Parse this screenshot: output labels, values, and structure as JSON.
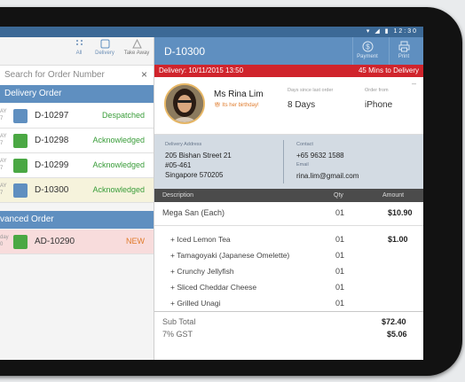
{
  "statusbar": {
    "time": "12:30"
  },
  "filters": [
    {
      "label": "All",
      "icon": "grid-icon"
    },
    {
      "label": "Delivery",
      "icon": "box-icon"
    },
    {
      "label": "Take Away",
      "icon": "triangle-icon"
    }
  ],
  "search": {
    "placeholder": "Search for Order Number"
  },
  "delivery_section": {
    "title": "Delivery Order"
  },
  "delivery_orders": [
    {
      "time_top": "AY",
      "time_bottom": "7",
      "id": "D-10297",
      "status": "Despatched",
      "status_color": "#3a9d3a",
      "square_color": "#5f8fc0",
      "bg": "#ffffff"
    },
    {
      "time_top": "AY",
      "time_bottom": "7",
      "id": "D-10298",
      "status": "Acknowledged",
      "status_color": "#3a9d3a",
      "square_color": "#4aa843",
      "bg": "#ffffff"
    },
    {
      "time_top": "AY",
      "time_bottom": "7",
      "id": "D-10299",
      "status": "Acknowledged",
      "status_color": "#3a9d3a",
      "square_color": "#4aa843",
      "bg": "#ffffff"
    },
    {
      "time_top": "AY",
      "time_bottom": "7",
      "id": "D-10300",
      "status": "Acknowledged",
      "status_color": "#3a9d3a",
      "square_color": "#5f8fc0",
      "bg": "#f6f3dc"
    }
  ],
  "advanced_section": {
    "title": "vanced Order"
  },
  "advanced_orders": [
    {
      "time_top": "day",
      "time_bottom": "0",
      "id": "AD-10290",
      "status": "NEW",
      "status_color": "#e07b2b",
      "square_color": "#4aa843",
      "bg": "#f8dcdc"
    }
  ],
  "detail": {
    "order_id": "D-10300",
    "payment_label": "Payment",
    "print_label": "Print",
    "delivery_banner": "Delivery: 10/11/2015 13:50",
    "eta_banner": "45 Mins to Delivery",
    "customer": {
      "name": "Ms Rina Lim",
      "birthday_note": "Its her birthday!",
      "days_label": "Days since last order",
      "days_value": "8 Days",
      "order_from_label": "Order from",
      "order_from_value": "iPhone"
    },
    "address_label": "Delivery Address",
    "address_line1": "205 Bishan Street 21",
    "address_line2": "#05-461",
    "address_line3": "Singapore 570205",
    "contact_label": "Contact",
    "contact_value": "+65 9632 1588",
    "email_label": "Email",
    "email_value": "rina.lim@gmail.com",
    "columns": {
      "description": "Description",
      "qty": "Qty",
      "amount": "Amount"
    },
    "items": [
      {
        "desc": "Mega San (Each)",
        "qty": "01",
        "amount": "$10.90",
        "indent": false
      },
      {
        "desc": "+ Iced Lemon Tea",
        "qty": "01",
        "amount": "$1.00",
        "indent": true
      },
      {
        "desc": "+ Tamagoyaki (Japanese Omelette)",
        "qty": "01",
        "amount": "",
        "indent": true
      },
      {
        "desc": "+ Crunchy Jellyfish",
        "qty": "01",
        "amount": "",
        "indent": true
      },
      {
        "desc": "+ Sliced Cheddar Cheese",
        "qty": "01",
        "amount": "",
        "indent": true
      },
      {
        "desc": "+ Grilled Unagi",
        "qty": "01",
        "amount": "",
        "indent": true
      }
    ],
    "subtotal_label": "Sub Total",
    "subtotal_value": "$72.40",
    "gst_label": "7% GST",
    "gst_value": "$5.06"
  },
  "nav": {
    "back": "◁",
    "home": "○",
    "recent": "□"
  }
}
